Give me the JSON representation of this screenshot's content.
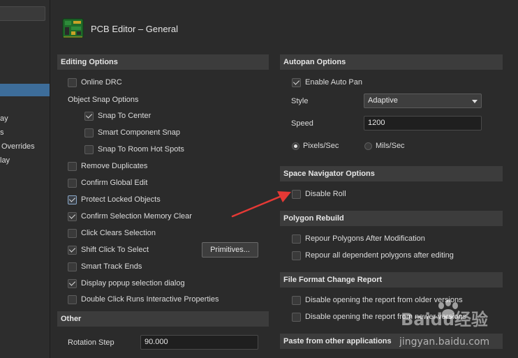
{
  "window": {
    "title": "PCB Editor – General"
  },
  "left_tree": {
    "items": [
      "ay",
      "s",
      "Overrides",
      "lay"
    ]
  },
  "sections": {
    "editing_options": {
      "header": "Editing Options",
      "online_drc": "Online DRC",
      "object_snap_options": "Object Snap Options",
      "snap_to_center": "Snap To Center",
      "smart_component_snap": "Smart Component Snap",
      "snap_to_room_hot_spots": "Snap To Room Hot Spots",
      "remove_duplicates": "Remove Duplicates",
      "confirm_global_edit": "Confirm Global Edit",
      "protect_locked_objects": "Protect Locked Objects",
      "confirm_selection_memory_clear": "Confirm Selection Memory Clear",
      "click_clears_selection": "Click Clears Selection",
      "shift_click_to_select": "Shift Click To Select",
      "primitives_button": "Primitives...",
      "smart_track_ends": "Smart Track Ends",
      "display_popup_selection_dialog": "Display popup selection dialog",
      "double_click_runs_interactive_properties": "Double Click Runs Interactive Properties"
    },
    "other": {
      "header": "Other",
      "rotation_step_label": "Rotation Step",
      "rotation_step_value": "90.000"
    },
    "autopan": {
      "header": "Autopan Options",
      "enable_auto_pan": "Enable Auto Pan",
      "style_label": "Style",
      "style_value": "Adaptive",
      "speed_label": "Speed",
      "speed_value": "1200",
      "pixels_sec": "Pixels/Sec",
      "mils_sec": "Mils/Sec"
    },
    "space_navigator": {
      "header": "Space Navigator Options",
      "disable_roll": "Disable Roll"
    },
    "polygon_rebuild": {
      "header": "Polygon Rebuild",
      "repour_after_modification": "Repour Polygons After Modification",
      "repour_dependent": "Repour all dependent polygons after editing"
    },
    "file_format": {
      "header": "File Format Change Report",
      "disable_older": "Disable opening the report from older versions",
      "disable_newer": "Disable opening the report from newer versions"
    },
    "paste": {
      "header": "Paste from other applications"
    }
  },
  "watermark": {
    "brand": "Baidu经验",
    "url": "jingyan.baidu.com"
  },
  "colors": {
    "background": "#2b2b2b",
    "section_header": "#3c3c3c",
    "selected": "#3d6d9a",
    "annotation_arrow": "#e53935"
  }
}
